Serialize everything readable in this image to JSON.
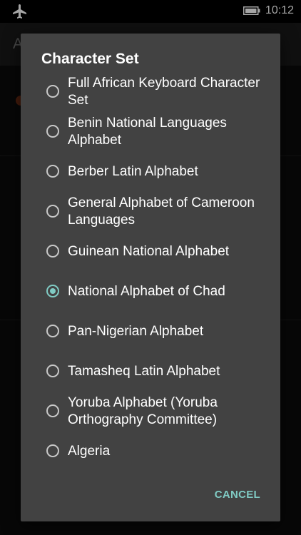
{
  "status_bar": {
    "time": "10:12",
    "icons": [
      "airplane-icon",
      "battery-icon"
    ]
  },
  "background_app": {
    "title": "A"
  },
  "dialog": {
    "title": "Character Set",
    "accent_color": "#80cbc4",
    "background_color": "#424242",
    "options": [
      {
        "label": "Full African Keyboard Character Set",
        "selected": false
      },
      {
        "label": "Benin National Languages Alphabet",
        "selected": false
      },
      {
        "label": "Berber Latin Alphabet",
        "selected": false
      },
      {
        "label": "General Alphabet of Cameroon Languages",
        "selected": false
      },
      {
        "label": "Guinean National Alphabet",
        "selected": false
      },
      {
        "label": "National Alphabet of Chad",
        "selected": true
      },
      {
        "label": "Pan-Nigerian Alphabet",
        "selected": false
      },
      {
        "label": "Tamasheq Latin Alphabet",
        "selected": false
      },
      {
        "label": "Yoruba Alphabet (Yoruba Orthography Committee)",
        "selected": false
      },
      {
        "label": "Algeria",
        "selected": false
      }
    ],
    "cancel_label": "CANCEL"
  }
}
